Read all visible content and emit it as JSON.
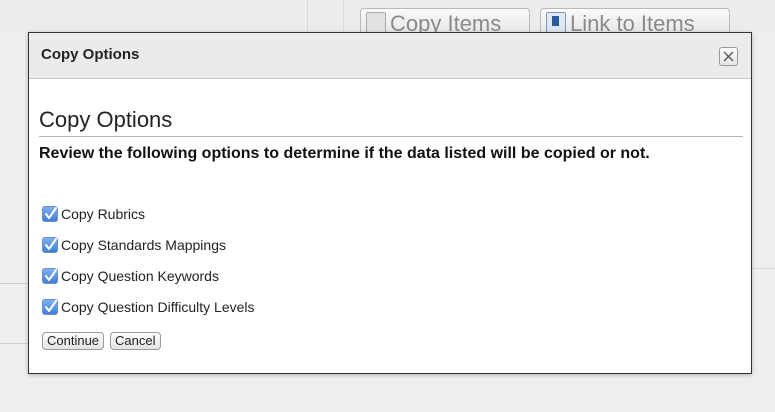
{
  "background": {
    "copy_items_label": "Copy Items",
    "link_to_items_label": "Link to Items"
  },
  "dialog": {
    "title": "Copy Options",
    "close_icon": "close-icon",
    "heading": "Copy Options",
    "intro": "Review the following options to determine if the data listed will be copied or not.",
    "options": [
      {
        "label": "Copy Rubrics",
        "checked": true
      },
      {
        "label": "Copy Standards Mappings",
        "checked": true
      },
      {
        "label": "Copy Question Keywords",
        "checked": true
      },
      {
        "label": "Copy Question Difficulty Levels",
        "checked": true
      }
    ],
    "continue_label": "Continue",
    "cancel_label": "Cancel"
  },
  "colors": {
    "checkbox_fill": "#3f7fd6",
    "dialog_border": "#333333",
    "titlebar_bg": "#ebebeb"
  }
}
